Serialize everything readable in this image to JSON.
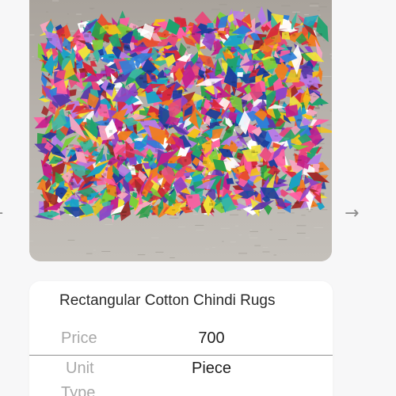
{
  "product": {
    "image_alt": "Multicolor rectangular cotton chindi rug on a stone floor",
    "title": "Rectangular Cotton Chindi Rugs"
  },
  "carousel": {
    "prev_arrow": "←",
    "next_arrow": "→"
  },
  "specs": [
    {
      "label": "Price",
      "value": "700"
    },
    {
      "label": "Unit",
      "value": "Piece"
    },
    {
      "label": "Type",
      "value": ""
    }
  ],
  "colors": {
    "floor": "#b8b2ab",
    "card_background": "#ffffff",
    "page_background": "#f7f7f8",
    "label": "#a8a8a8",
    "value": "#1f1f1f",
    "divider": "#8f8f8f"
  }
}
